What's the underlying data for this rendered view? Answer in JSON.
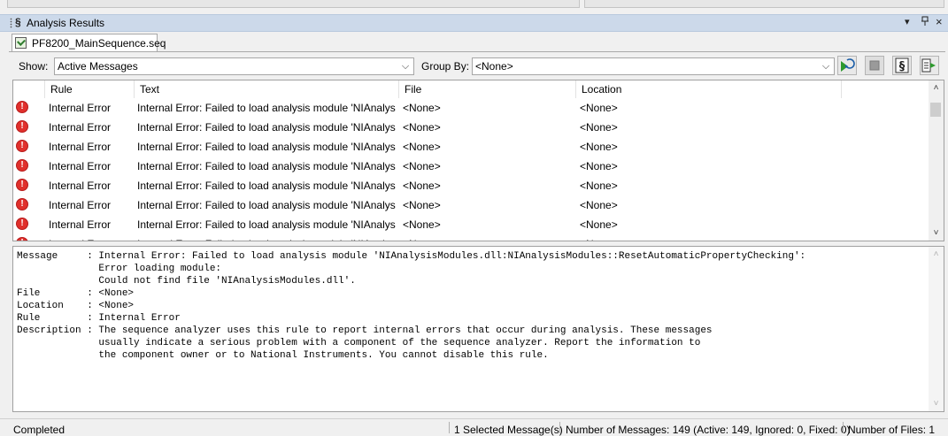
{
  "panel": {
    "title": "Analysis Results",
    "controls": {
      "dropdown": "▾",
      "pin": "ᵖ",
      "close": "×"
    }
  },
  "doc_tab": {
    "label": "PF8200_MainSequence.seq"
  },
  "toolbar": {
    "show_label": "Show:",
    "show_value": "Active Messages",
    "group_label": "Group By:",
    "group_value": "<None>"
  },
  "table": {
    "columns": [
      "Rule",
      "Text",
      "File",
      "Location"
    ],
    "rows": [
      {
        "rule": "Internal Error",
        "text": "Internal Error: Failed to load analysis module 'NIAnalysisMod...",
        "file": "<None>",
        "location": "<None>"
      },
      {
        "rule": "Internal Error",
        "text": "Internal Error: Failed to load analysis module 'NIAnalysisMod...",
        "file": "<None>",
        "location": "<None>"
      },
      {
        "rule": "Internal Error",
        "text": "Internal Error: Failed to load analysis module 'NIAnalysisMod...",
        "file": "<None>",
        "location": "<None>"
      },
      {
        "rule": "Internal Error",
        "text": "Internal Error: Failed to load analysis module 'NIAnalysisMod...",
        "file": "<None>",
        "location": "<None>"
      },
      {
        "rule": "Internal Error",
        "text": "Internal Error: Failed to load analysis module 'NIAnalysisMod...",
        "file": "<None>",
        "location": "<None>"
      },
      {
        "rule": "Internal Error",
        "text": "Internal Error: Failed to load analysis module 'NIAnalysisMod...",
        "file": "<None>",
        "location": "<None>"
      },
      {
        "rule": "Internal Error",
        "text": "Internal Error: Failed to load analysis module 'NIAnalysisMod...",
        "file": "<None>",
        "location": "<None>"
      },
      {
        "rule": "Internal Error",
        "text": "Internal Error: Failed to load analysis module 'NIAnalysisMod...",
        "file": "<None>",
        "location": "<None>"
      }
    ]
  },
  "detail": {
    "text": "Message     : Internal Error: Failed to load analysis module 'NIAnalysisModules.dll:NIAnalysisModules::ResetAutomaticPropertyChecking':\n              Error loading module:\n              Could not find file 'NIAnalysisModules.dll'.\nFile        : <None>\nLocation    : <None>\nRule        : Internal Error\nDescription : The sequence analyzer uses this rule to report internal errors that occur during analysis. These messages\n              usually indicate a serious problem with a component of the sequence analyzer. Report the information to\n              the component owner or to National Instruments. You cannot disable this rule."
  },
  "status": {
    "state": "Completed",
    "selected": "1 Selected Message(s)",
    "messages": "Number of Messages: 149 (Active: 149, Ignored: 0, Fixed: 0)",
    "files": "Number of Files: 1"
  },
  "icons": {
    "error": "error-circle-icon",
    "start": "start-analysis-icon",
    "stop": "stop-analysis-icon",
    "analyzer": "analyzer-icon",
    "next": "next-message-icon"
  },
  "colors": {
    "title_bar": "#ccd9ea",
    "error": "#e0302c"
  }
}
